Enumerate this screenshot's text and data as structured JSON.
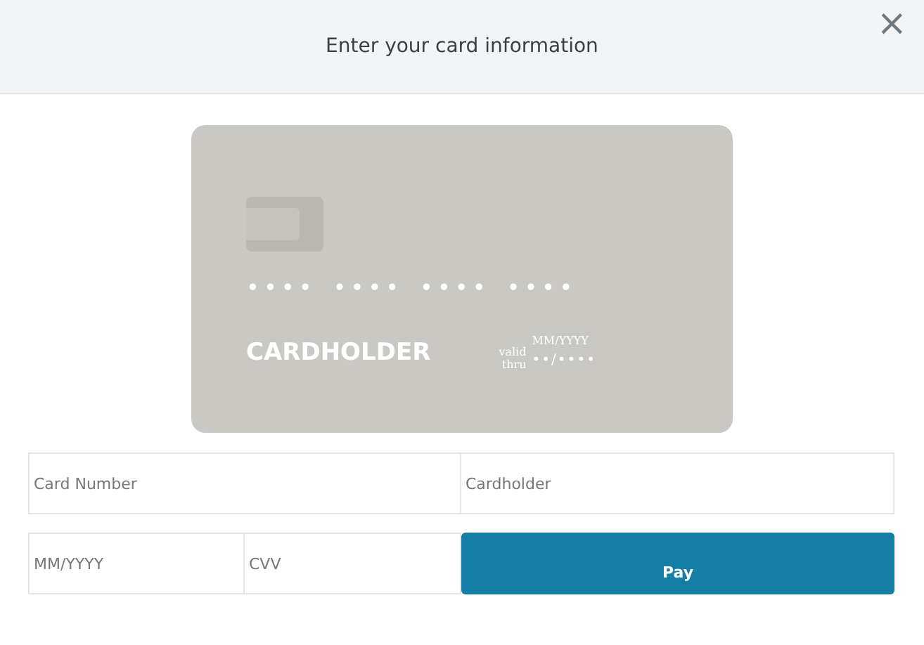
{
  "dialog": {
    "title": "Enter your card information",
    "close": "×"
  },
  "card_preview": {
    "number_groups": [
      "••••",
      "••••",
      "••••",
      "••••"
    ],
    "cardholder": "CARDHOLDER",
    "expiry_label": "valid thru",
    "expiry_format": "MM/YYYY",
    "expiry": "••/••••"
  },
  "fields": [
    {
      "placeholder": "Card Number"
    },
    {
      "placeholder": "Cardholder"
    },
    {
      "placeholder": "MM/YYYY"
    },
    {
      "placeholder": "CVV"
    }
  ],
  "pay_button": "Pay"
}
